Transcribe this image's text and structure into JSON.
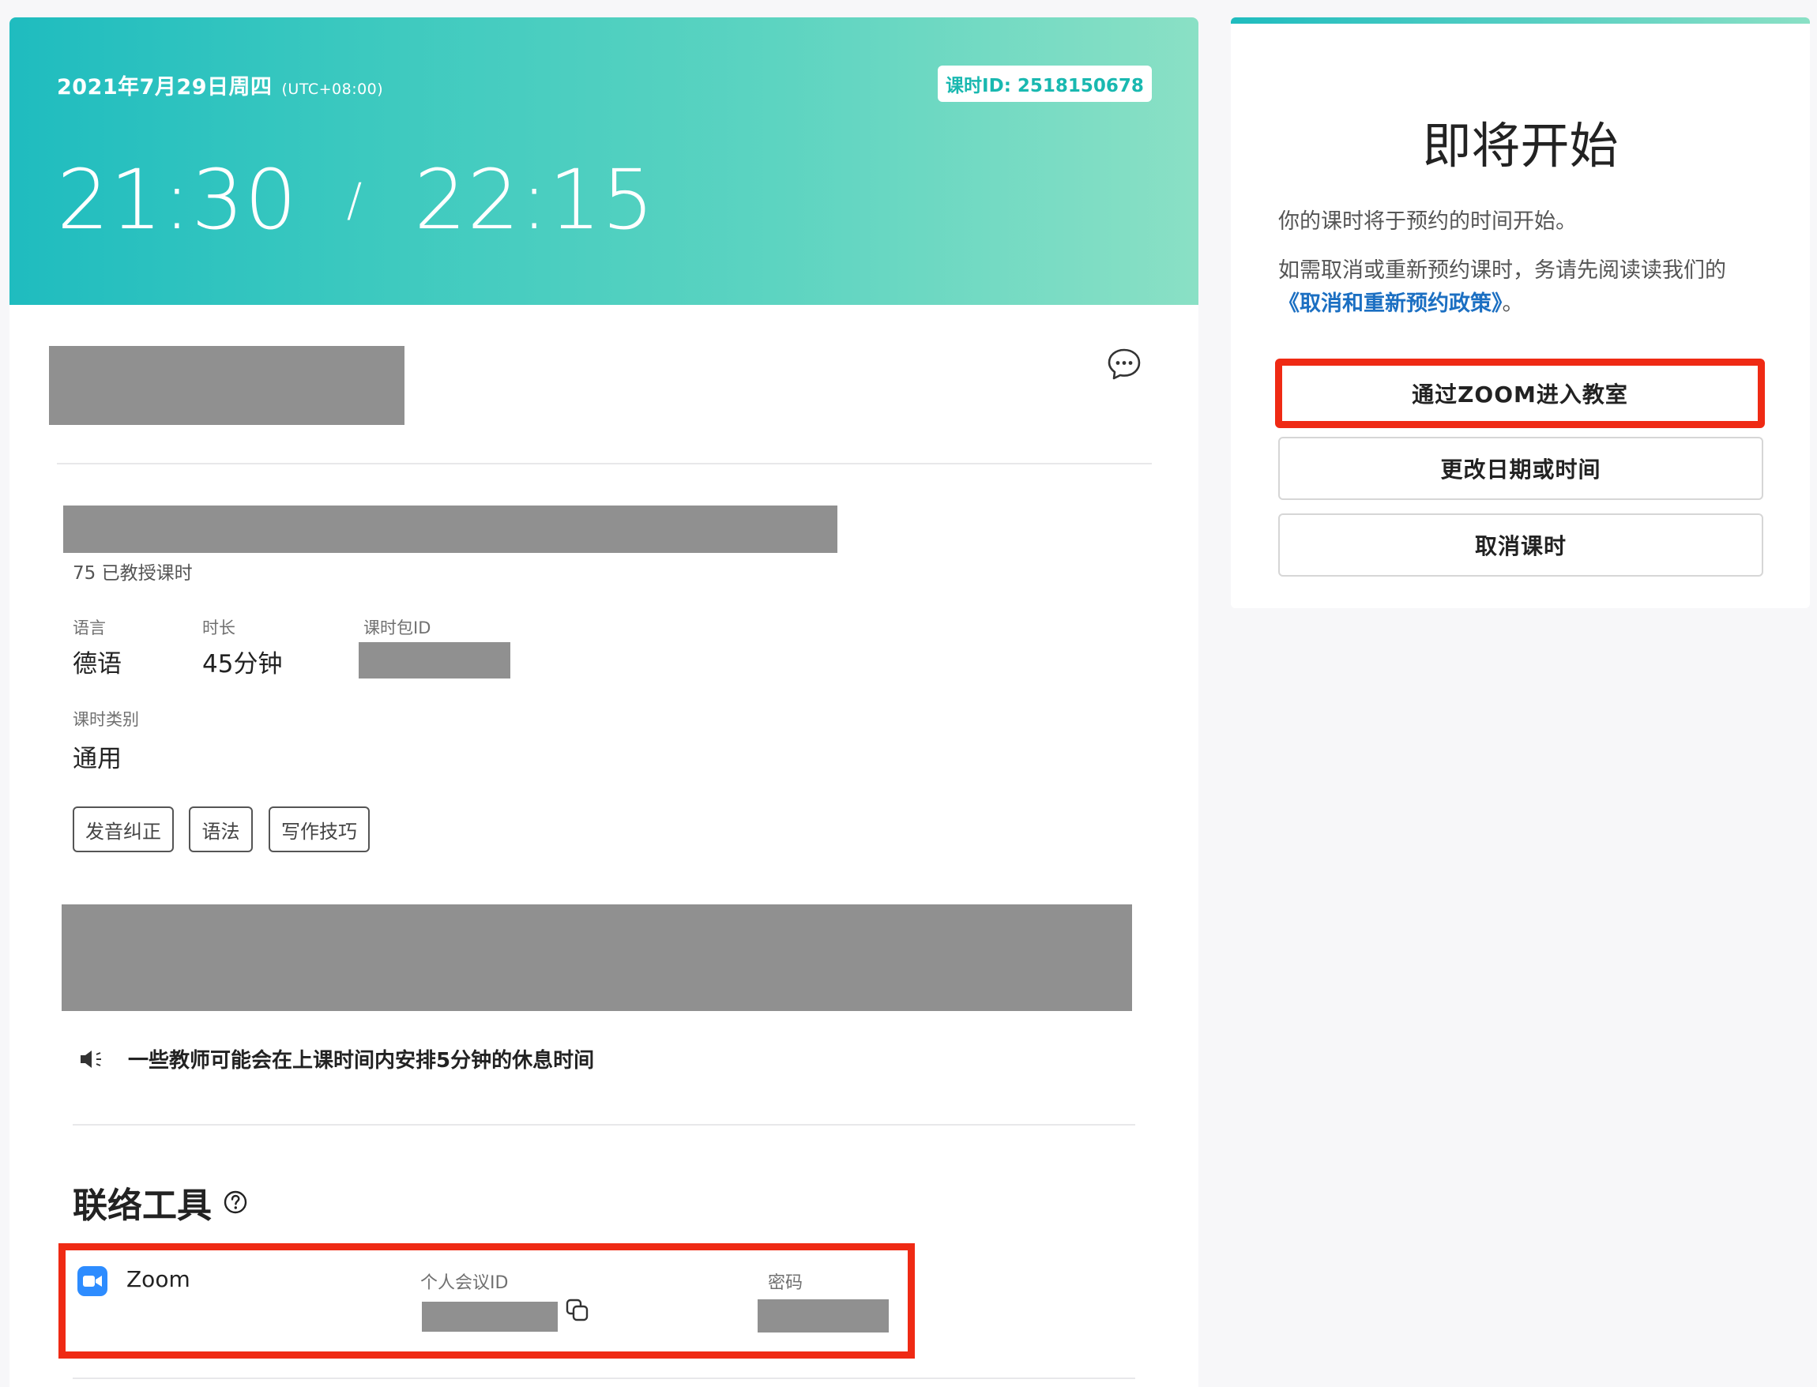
{
  "lesson": {
    "date": "2021年7月29日周四",
    "timezone": "(UTC+08:00)",
    "lesson_id_label": "课时ID: 2518150678",
    "start_time": "21:30",
    "separator": "/",
    "end_time": "22:15",
    "taught_count": "75 已教授课时",
    "language_label": "语言",
    "language_value": "德语",
    "duration_label": "时长",
    "duration_value": "45分钟",
    "package_id_label": "课时包ID",
    "category_label": "课时类别",
    "category_value": "通用",
    "tags": [
      "发音纠正",
      "语法",
      "写作技巧"
    ],
    "notice": "一些教师可能会在上课时间内安排5分钟的休息时间"
  },
  "contact": {
    "title": "联络工具",
    "tool_name": "Zoom",
    "meeting_id_label": "个人会议ID",
    "password_label": "密码"
  },
  "side": {
    "heading": "即将开始",
    "line1": "你的课时将于预约的时间开始。",
    "line2": "如需取消或重新预约课时，务请先阅读读我们的",
    "policy_link": "《取消和重新预约政策》",
    "policy_suffix": "。",
    "enter_zoom_button": "通过ZOOM进入教室",
    "reschedule_button": "更改日期或时间",
    "cancel_button": "取消课时"
  },
  "colors": {
    "accent": "#1fbcbf",
    "accent_light": "#8ae0c5",
    "highlight": "#ef2a14",
    "link": "#1b6fc2"
  }
}
